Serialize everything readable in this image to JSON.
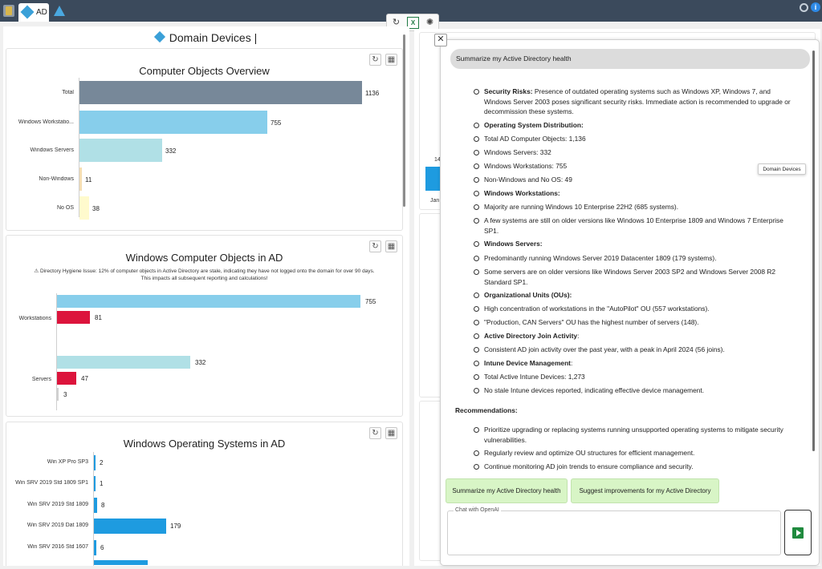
{
  "topbar": {
    "tab_label": "AD"
  },
  "pane": {
    "title": "Domain Devices |"
  },
  "card1": {
    "title": "Computer Objects Overview",
    "bars": [
      {
        "label": "Total",
        "value": "1136",
        "color": "#778899"
      },
      {
        "label": "Windows Workstatio...",
        "value": "755",
        "color": "#87ceeb"
      },
      {
        "label": "Windows Servers",
        "value": "332",
        "color": "#b0e0e6"
      },
      {
        "label": "Non-Windows",
        "value": "11",
        "color": "#f5deb3"
      },
      {
        "label": "No OS",
        "value": "38",
        "color": "#fffacd"
      }
    ]
  },
  "card2": {
    "title": "Windows Computer Objects in AD",
    "warning_line1": "Directory Hygiene Issue: 12% of computer objects in Active Directory are stale, indicating they have not logged onto the domain for over 90 days.",
    "warning_line2": "This impacts all subsequent reporting and calculations!",
    "groups": [
      {
        "label": "Workstations",
        "values": [
          "755",
          "81"
        ]
      },
      {
        "label": "Servers",
        "values": [
          "332",
          "47",
          "3"
        ]
      }
    ]
  },
  "card3": {
    "title": "Windows Operating Systems in AD",
    "bars": [
      {
        "label": "Win XP Pro  SP3",
        "value": "2"
      },
      {
        "label": "Win SRV 2019 Std 1809 SP1",
        "value": "1"
      },
      {
        "label": "Win SRV 2019 Std 1809",
        "value": "8"
      },
      {
        "label": "Win SRV 2019 Dat 1809",
        "value": "179"
      },
      {
        "label": "Win SRV 2016 Std 1607",
        "value": "6"
      }
    ]
  },
  "background": {
    "value_14": "14",
    "jan": "Jan"
  },
  "chat": {
    "question": "Summarize my Active Directory health",
    "tooltip": "Domain Devices",
    "items": [
      {
        "bold": "Security Risks:",
        "text": " Presence of outdated operating systems such as Windows XP, Windows 7, and Windows Server 2003 poses significant security risks. Immediate action is recommended to upgrade or decommission these systems."
      },
      {
        "bold": "Operating System Distribution:",
        "text": ""
      },
      {
        "bold": "",
        "text": "Total AD Computer Objects: 1,136"
      },
      {
        "bold": "",
        "text": "Windows Servers: 332"
      },
      {
        "bold": "",
        "text": "Windows Workstations: 755"
      },
      {
        "bold": "",
        "text": "Non-Windows and No OS: 49"
      },
      {
        "bold": "Windows Workstations:",
        "text": ""
      },
      {
        "bold": "",
        "text": "Majority are running Windows 10 Enterprise 22H2 (685 systems)."
      },
      {
        "bold": "",
        "text": "A few systems are still on older versions like Windows 10 Enterprise 1809 and Windows 7 Enterprise SP1."
      },
      {
        "bold": "Windows Servers:",
        "text": ""
      },
      {
        "bold": "",
        "text": "Predominantly running Windows Server 2019 Datacenter 1809 (179 systems)."
      },
      {
        "bold": "",
        "text": "Some servers are on older versions like Windows Server 2003 SP2 and Windows Server 2008 R2 Standard SP1."
      },
      {
        "bold": "Organizational Units (OUs):",
        "text": ""
      },
      {
        "bold": "",
        "text": "High concentration of workstations in the \"AutoPilot\" OU (557 workstations)."
      },
      {
        "bold": "",
        "text": "\"Production, CAN Servers\" OU has the highest number of servers (148)."
      },
      {
        "bold": "Active Directory Join Activity",
        "text": ":"
      },
      {
        "bold": "",
        "text": "Consistent AD join activity over the past year, with a peak in April 2024 (56 joins)."
      },
      {
        "bold": "Intune Device Management",
        "text": ":"
      },
      {
        "bold": "",
        "text": "Total Active Intune Devices: 1,273"
      },
      {
        "bold": "",
        "text": "No stale Intune devices reported, indicating effective device management."
      }
    ],
    "recommendations_heading": "Recommendations:",
    "recommendations": [
      "Prioritize upgrading or replacing systems running unsupported operating systems to mitigate security vulnerabilities.",
      "Regularly review and optimize OU structures for efficient management.",
      "Continue monitoring AD join trends to ensure compliance and security."
    ],
    "suggestion1": "Summarize my Active Directory health",
    "suggestion2": "Suggest improvements for my Active Directory",
    "input_label": "Chat with OpenAI",
    "input_value": ""
  }
}
